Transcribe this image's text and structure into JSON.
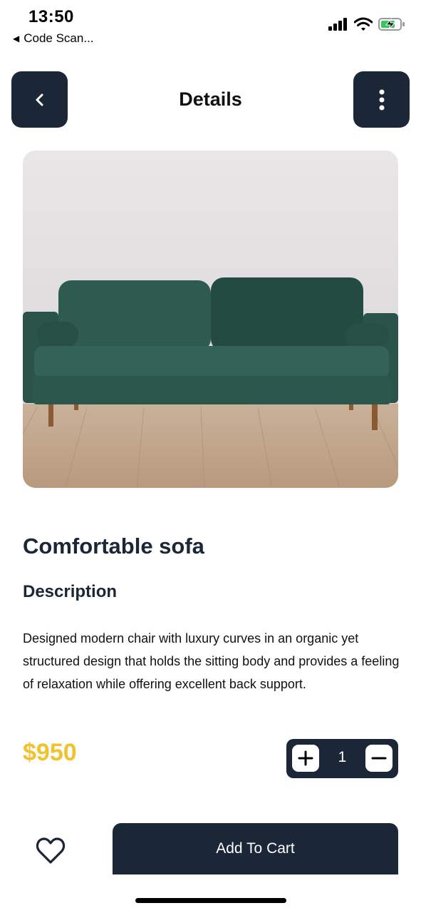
{
  "status_bar": {
    "time": "13:50",
    "back_app": "Code Scan...",
    "icons": [
      "cellular-signal-icon",
      "wifi-icon",
      "battery-charging-icon"
    ]
  },
  "header": {
    "title": "Details",
    "back_icon": "chevron-left-icon",
    "menu_icon": "more-vertical-icon"
  },
  "product": {
    "image_alt": "green-velvet-sofa-photo",
    "name": "Comfortable sofa",
    "description_heading": "Description",
    "description": "Designed modern chair with luxury curves in an organic yet structured design that holds the sitting body and provides a feeling of relaxation while offering excellent back support.",
    "price": "$950",
    "quantity": "1"
  },
  "actions": {
    "favorite_icon": "heart-outline-icon",
    "add_to_cart": "Add To Cart"
  },
  "colors": {
    "primary": "#1b2637",
    "price": "#f2c12e",
    "background": "#ffffff"
  }
}
